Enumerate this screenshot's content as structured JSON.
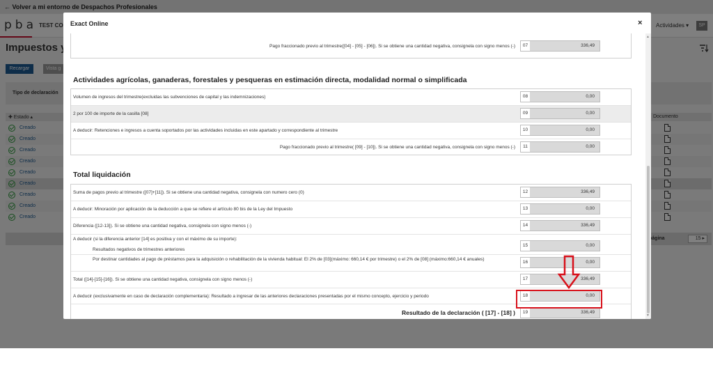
{
  "app": {
    "back_link": "← Volver a mi entorno de Despachos Profesionales",
    "logo": "pba",
    "company": "TEST CO",
    "actividades": "Actividades ▾",
    "avatar": "SP",
    "page_title": "Impuestos y",
    "filter_icon": "ĭŸ",
    "recargar": "Recargar",
    "vista": "Vista g",
    "tipo_declaracion": "Tipo de declaración",
    "estado_header": "✚ Estado ▴",
    "documento_header": "Documento",
    "row_status": "Creado",
    "rows": [
      "Creado",
      "Creado",
      "Creado",
      "Creado",
      "Creado",
      "Creado",
      "Creado",
      "Creado",
      "Creado"
    ],
    "pager_label": "página",
    "pager_value": "15 ▸"
  },
  "modal": {
    "title": "Exact Online",
    "close": "×",
    "top_row": {
      "text": "Pago fraccionado previo al trimestre([04] - [05] - [06]). Si se obtiene una cantidad negativa, consignela con signo menos (-)",
      "num": "07",
      "value": "336,49"
    },
    "section_agri": {
      "title": "Actividades agrícolas, ganaderas, forestales y pesqueras en estimación directa, modalidad normal o simplificada",
      "rows": [
        {
          "text": "Volumen de ingresos del trimestre(excluidas las subvenciones de capital y las indemnizaciones)",
          "num": "08",
          "value": "0,00"
        },
        {
          "text": "2 por 100 de importe de la casilla [08]",
          "num": "09",
          "value": "0,00"
        },
        {
          "text": "A deducir: Retenciones e ingresos a cuenta soportados por las actividades incluidas en este apartado y correspondiente al trimestre",
          "num": "10",
          "value": "0,00"
        },
        {
          "text": "Pago fraccionado previo al trimestre( [09] - [10]). Si se obtiene una cantidad negativa, consignela con signo menos (-)",
          "num": "11",
          "value": "0,00"
        }
      ]
    },
    "section_total": {
      "title": "Total liquidación",
      "rows": [
        {
          "text": "Suma de pagos previo al trimestre ([07]+[11]). Si se obtiene una cantidad negativa, consignela con numero cero (0)",
          "num": "12",
          "value": "336,49"
        },
        {
          "text": "A deducir: Minoración por aplicación de la deducción a que se refiere el artículo 80 bis de la Ley del Impuesto",
          "num": "13",
          "value": "0,00"
        },
        {
          "text": "Diferencia ([12-13]). Si se obtiene una cantidad negativa, consignela con signo menos (-)",
          "num": "14",
          "value": "336,49"
        },
        {
          "text": "A deducir (si la diferencia anterior [14] es positiva y con el máximo de su importe):",
          "sub": "Resultados negativos de trimestres anteriores",
          "num": "15",
          "value": "0,00"
        },
        {
          "text": "Por destinar cantidades al pago de préstamos para la adquisición o rehabilitación de la vivienda habitual: El 2% de [03](máximo: 660,14 € por trimestre) o el 2% de [08] (máximo:660,14 € anuales)",
          "num": "16",
          "value": "0,00"
        },
        {
          "text": "Total ([14]-[15]-[16]). Si se obtiene una cantidad negativa, consignela con signo menos (-)",
          "num": "17",
          "value": "336,49"
        },
        {
          "text": "A deducir (exclusivamente en caso de declaración complementaria): Resultado a ingresar de las anteriores declaraciones presentadas por el mismo concepto, ejercicio y periodo",
          "num": "18",
          "value": "0,00"
        }
      ],
      "result": {
        "label": "Resultado de la declaración ( [17] - [18] )",
        "num": "19",
        "value": "336,49"
      }
    }
  },
  "colors": {
    "accent": "#1d5a93",
    "highlight": "#d8101a",
    "brand": "#c8102e",
    "status_ok": "#2e9b3d"
  }
}
